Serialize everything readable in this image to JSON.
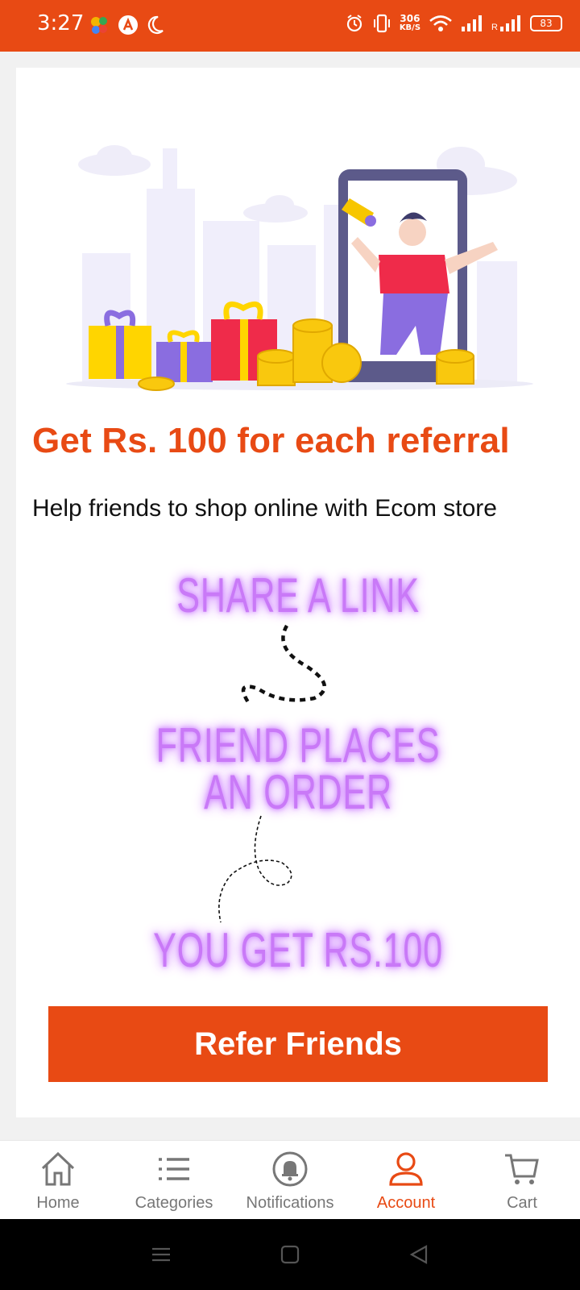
{
  "status": {
    "time": "3:27",
    "net_speed_value": "306",
    "net_speed_unit": "KB/S",
    "battery": "83",
    "roaming": "R"
  },
  "referral": {
    "headline": "Get Rs. 100 for each referral",
    "subline": "Help friends to shop online with Ecom store",
    "step1": "SHARE A LINK",
    "step2_line1": "FRIEND PLACES",
    "step2_line2": "AN ORDER",
    "step3": "YOU GET RS.100",
    "button_label": "Refer Friends"
  },
  "colors": {
    "accent": "#e84a14",
    "glow_text": "#c979f7"
  },
  "bottom_nav": [
    {
      "label": "Home",
      "icon": "home-icon"
    },
    {
      "label": "Categories",
      "icon": "list-icon"
    },
    {
      "label": "Notifications",
      "icon": "bell-icon"
    },
    {
      "label": "Account",
      "icon": "user-icon",
      "active": true
    },
    {
      "label": "Cart",
      "icon": "cart-icon"
    }
  ]
}
